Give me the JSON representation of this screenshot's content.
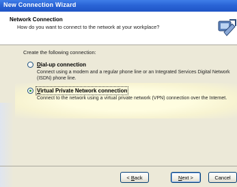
{
  "window": {
    "title": "New Connection Wizard"
  },
  "header": {
    "title": "Network Connection",
    "subtitle": "How do you want to connect to the network at your workplace?",
    "icon": "network-wizard-icon"
  },
  "content": {
    "instruction": "Create the following connection:",
    "options": [
      {
        "label_prefix": "D",
        "label_rest": "ial-up connection",
        "description": "Connect using a modem and a regular phone line or an Integrated Services Digital Network (ISDN) phone line.",
        "selected": false
      },
      {
        "label_prefix": "V",
        "label_rest": "irtual Private Network connection",
        "description": "Connect to the network using a virtual private network (VPN) connection over the Internet.",
        "selected": true
      }
    ]
  },
  "buttons": {
    "back_prefix": "< ",
    "back_u": "B",
    "back_rest": "ack",
    "next_u": "N",
    "next_rest": "ext >",
    "cancel": "Cancel"
  },
  "colors": {
    "titlebar": "#2a64d6",
    "dialog_bg": "#ece9d8",
    "header_bg": "#ffffff",
    "highlight": "#fffde0"
  }
}
